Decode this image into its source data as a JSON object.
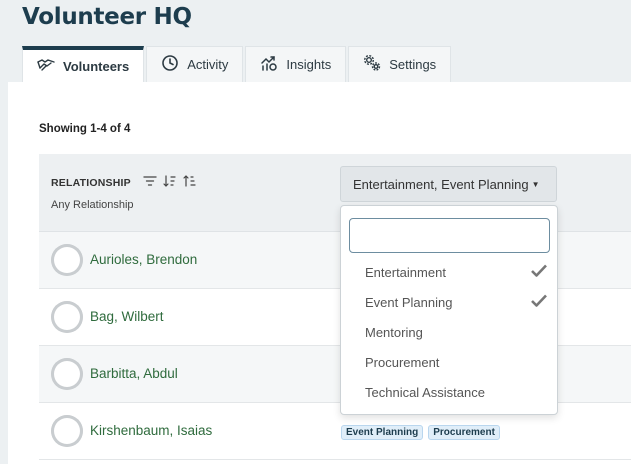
{
  "app": {
    "title": "Volunteer HQ"
  },
  "tabs": [
    {
      "label": "Volunteers",
      "icon": "handshake-icon",
      "active": true
    },
    {
      "label": "Activity",
      "icon": "clock-icon",
      "active": false
    },
    {
      "label": "Insights",
      "icon": "chart-trend-icon",
      "active": false
    },
    {
      "label": "Settings",
      "icon": "gears-icon",
      "active": false
    }
  ],
  "summary": {
    "showing": "Showing 1-4 of 4"
  },
  "table": {
    "column_header": "RELATIONSHIP",
    "column_filter_value": "Any Relationship",
    "interests_filter_label": "Entertainment, Event Planning",
    "rows": [
      {
        "name": "Aurioles, Brendon",
        "tags": []
      },
      {
        "name": "Bag, Wilbert",
        "tags": []
      },
      {
        "name": "Barbitta, Abdul",
        "tags": []
      },
      {
        "name": "Kirshenbaum, Isaias",
        "tags": [
          "Event Planning",
          "Procurement"
        ]
      }
    ]
  },
  "dropdown": {
    "search_value": "",
    "options": [
      {
        "label": "Entertainment",
        "checked": true
      },
      {
        "label": "Event Planning",
        "checked": true
      },
      {
        "label": "Mentoring",
        "checked": false
      },
      {
        "label": "Procurement",
        "checked": false
      },
      {
        "label": "Technical Assistance",
        "checked": false
      }
    ]
  },
  "colors": {
    "brand": "#1d3d4e",
    "link": "#2f6b3d",
    "tag_bg": "#e0eef9"
  }
}
